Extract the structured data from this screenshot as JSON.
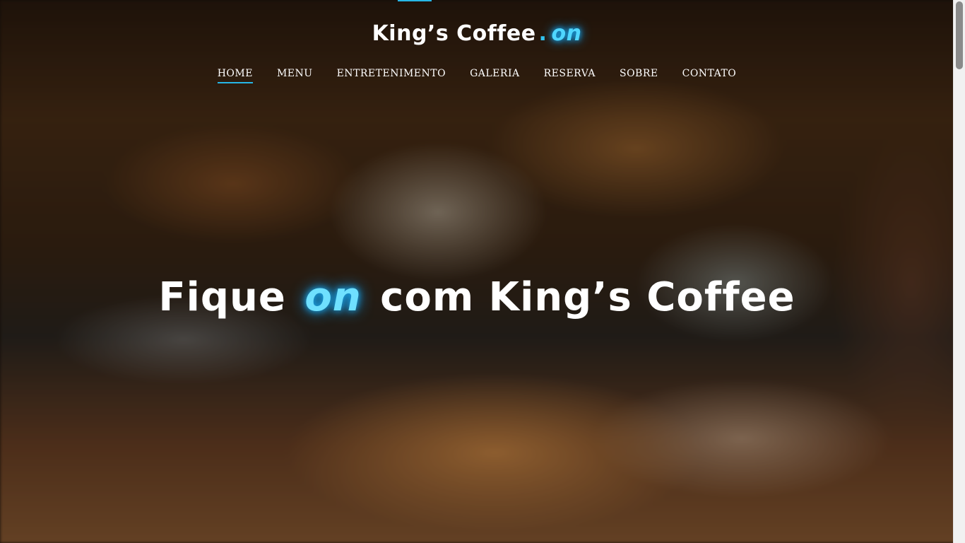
{
  "brand": {
    "name": "King’s Coffee",
    "dot": ".",
    "suffix": "on"
  },
  "nav": {
    "items": [
      {
        "label": "HOME",
        "active": true
      },
      {
        "label": "MENU",
        "active": false
      },
      {
        "label": "ENTRETENIMENTO",
        "active": false
      },
      {
        "label": "GALERIA",
        "active": false
      },
      {
        "label": "RESERVA",
        "active": false
      },
      {
        "label": "SOBRE",
        "active": false
      },
      {
        "label": "CONTATO",
        "active": false
      }
    ]
  },
  "hero": {
    "prefix": "Fique",
    "highlight": "on",
    "suffix": "com King’s Coffee"
  },
  "colors": {
    "accent": "#26b6e6",
    "glow": "#4fd6ff",
    "text": "#ffffff"
  }
}
